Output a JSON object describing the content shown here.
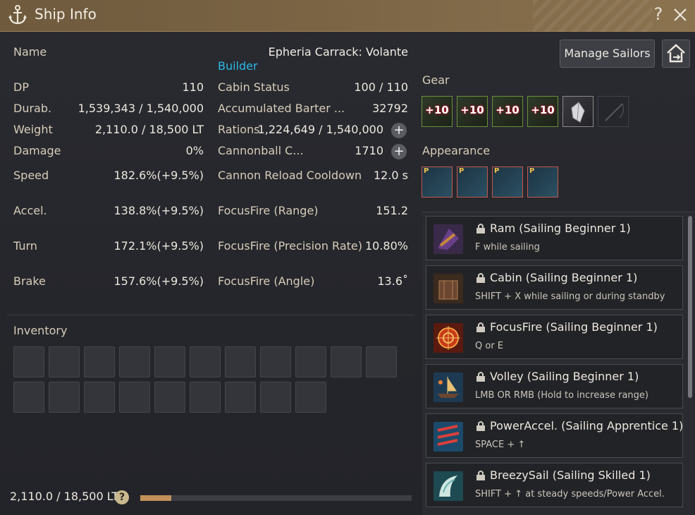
{
  "window": {
    "title": "Ship Info",
    "help": "?",
    "close": "×"
  },
  "ship": {
    "name_label": "Name",
    "name_value": "Epheria Carrack: Volante",
    "builder": "Builder"
  },
  "stats_left": [
    {
      "label": "DP",
      "value": "110"
    },
    {
      "label": "Durab.",
      "value": "1,539,343 / 1,540,000"
    },
    {
      "label": "Weight",
      "value": "2,110.0 / 18,500 LT"
    },
    {
      "label": "Damage",
      "value": "0%"
    },
    {
      "label": "Speed",
      "value": "182.6%(+9.5%)"
    },
    {
      "label": "Accel.",
      "value": "138.8%(+9.5%)"
    },
    {
      "label": "Turn",
      "value": "172.1%(+9.5%)"
    },
    {
      "label": "Brake",
      "value": "157.6%(+9.5%)"
    }
  ],
  "stats_right": [
    {
      "label": "Cabin Status",
      "value": "100 / 110"
    },
    {
      "label": "Accumulated Barter ...",
      "value": "32792"
    },
    {
      "label": "Rations",
      "value": "1,224,649 / 1,540,000"
    },
    {
      "label": "Cannonball C...",
      "value": "1710"
    },
    {
      "label": "Cannon Reload Cooldown",
      "value": "12.0 s"
    },
    {
      "label": "FocusFire (Range)",
      "value": "151.2"
    },
    {
      "label": "FocusFire (Precision Rate)",
      "value": "10.80%"
    },
    {
      "label": "FocusFire (Angle)",
      "value": "13.6˚"
    }
  ],
  "buttons": {
    "manage_sailors": "Manage Sailors",
    "plus": "+"
  },
  "gear": {
    "title": "Gear",
    "slots": [
      "+10",
      "+10",
      "+10",
      "+10",
      "",
      ""
    ]
  },
  "appearance": {
    "title": "Appearance",
    "badge": "P"
  },
  "inventory": {
    "title": "Inventory",
    "weight": "2,110.0 / 18,500 LT",
    "help": "?",
    "fill_fraction": 0.114
  },
  "skills": [
    {
      "name": "Ram (Sailing Beginner 1)",
      "key": "F while sailing",
      "icon": "ram-icon"
    },
    {
      "name": "Cabin (Sailing Beginner 1)",
      "key": "SHIFT + X while sailing or during standby",
      "icon": "cabin-icon"
    },
    {
      "name": "FocusFire (Sailing Beginner 1)",
      "key": "Q or E",
      "icon": "focusfire-icon"
    },
    {
      "name": "Volley (Sailing Beginner 1)",
      "key": "LMB OR RMB (Hold to increase range)",
      "icon": "volley-icon"
    },
    {
      "name": "PowerAccel. (Sailing Apprentice 1)",
      "key": "SPACE + ↑",
      "icon": "poweraccel-icon"
    },
    {
      "name": "BreezySail (Sailing Skilled 1)",
      "key": "SHIFT + ↑ at steady speeds/Power Accel.",
      "icon": "breezysail-icon"
    }
  ],
  "colors": {
    "builder": "#2cb8e6",
    "title_bar": "#7a6444",
    "weight_fill": "#c2915a"
  }
}
